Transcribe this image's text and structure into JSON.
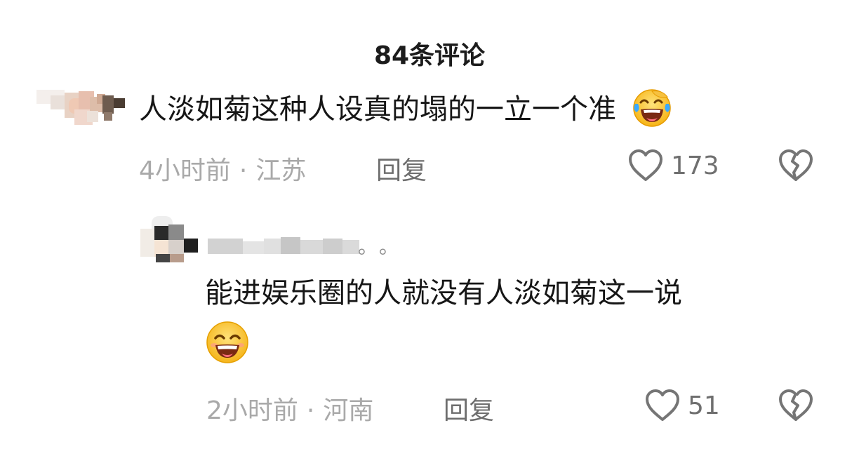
{
  "header": {
    "title": "84条评论"
  },
  "comments": [
    {
      "text": "人淡如菊这种人设真的塌的一立一个准",
      "emoji_icon": "rofl-crying-laughing-emoji",
      "time": "4小时前",
      "location": "江苏",
      "reply_label": "回复",
      "likes": "173"
    },
    {
      "text_line1": "能进娱乐圈的人就没有人淡如菊这一说",
      "emoji_icon": "grinning-smile-emoji",
      "time": "2小时前",
      "location": "河南",
      "reply_label": "回复",
      "likes": "51",
      "username_suffix": "。。"
    }
  ],
  "icons": {
    "like": "heart-outline-icon",
    "dislike": "broken-heart-icon"
  },
  "colors": {
    "meta_text": "#a9a9a9",
    "action_text": "#6e6e6e",
    "icon_gray": "#757575"
  }
}
